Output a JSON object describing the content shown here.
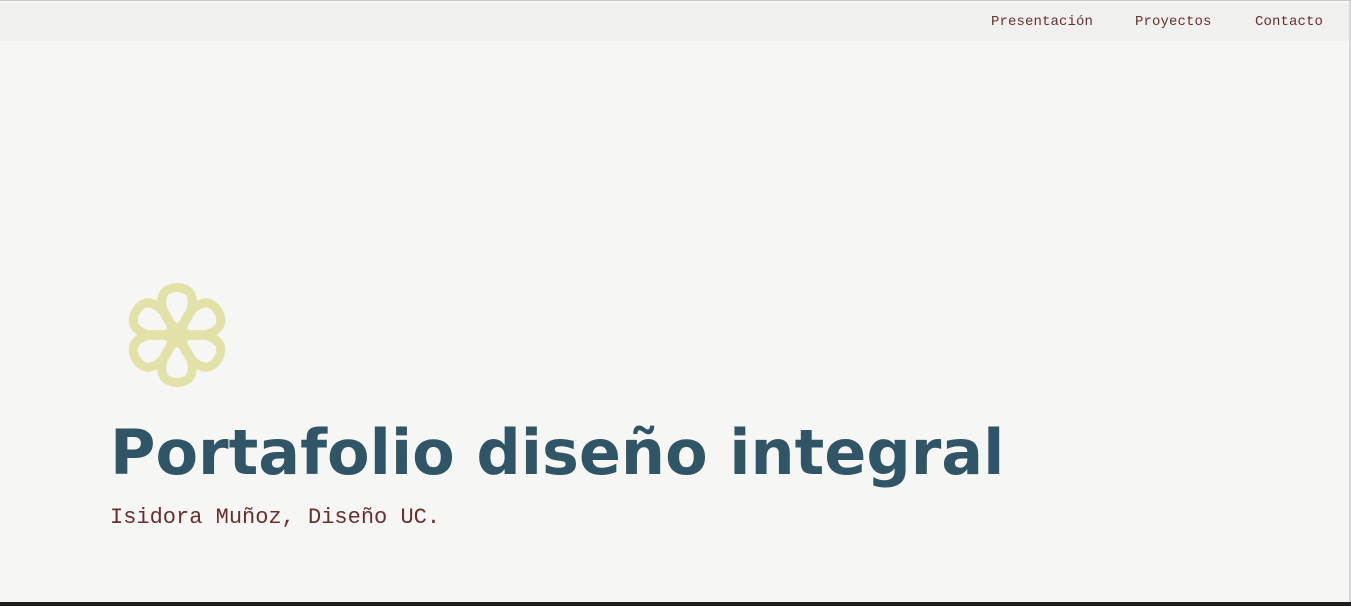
{
  "nav": {
    "items": [
      {
        "label": "Presentación"
      },
      {
        "label": "Proyectos"
      },
      {
        "label": "Contacto"
      }
    ]
  },
  "hero": {
    "logo_icon": "flower-icon",
    "title": "Portafolio diseño integral",
    "subtitle": "Isidora Muñoz, Diseño UC."
  },
  "colors": {
    "background": "#f6f6f4",
    "navbar": "#f0f0ee",
    "title": "#2f5566",
    "text_accent": "#6a2f2b",
    "logo": "#e2e2a8"
  }
}
